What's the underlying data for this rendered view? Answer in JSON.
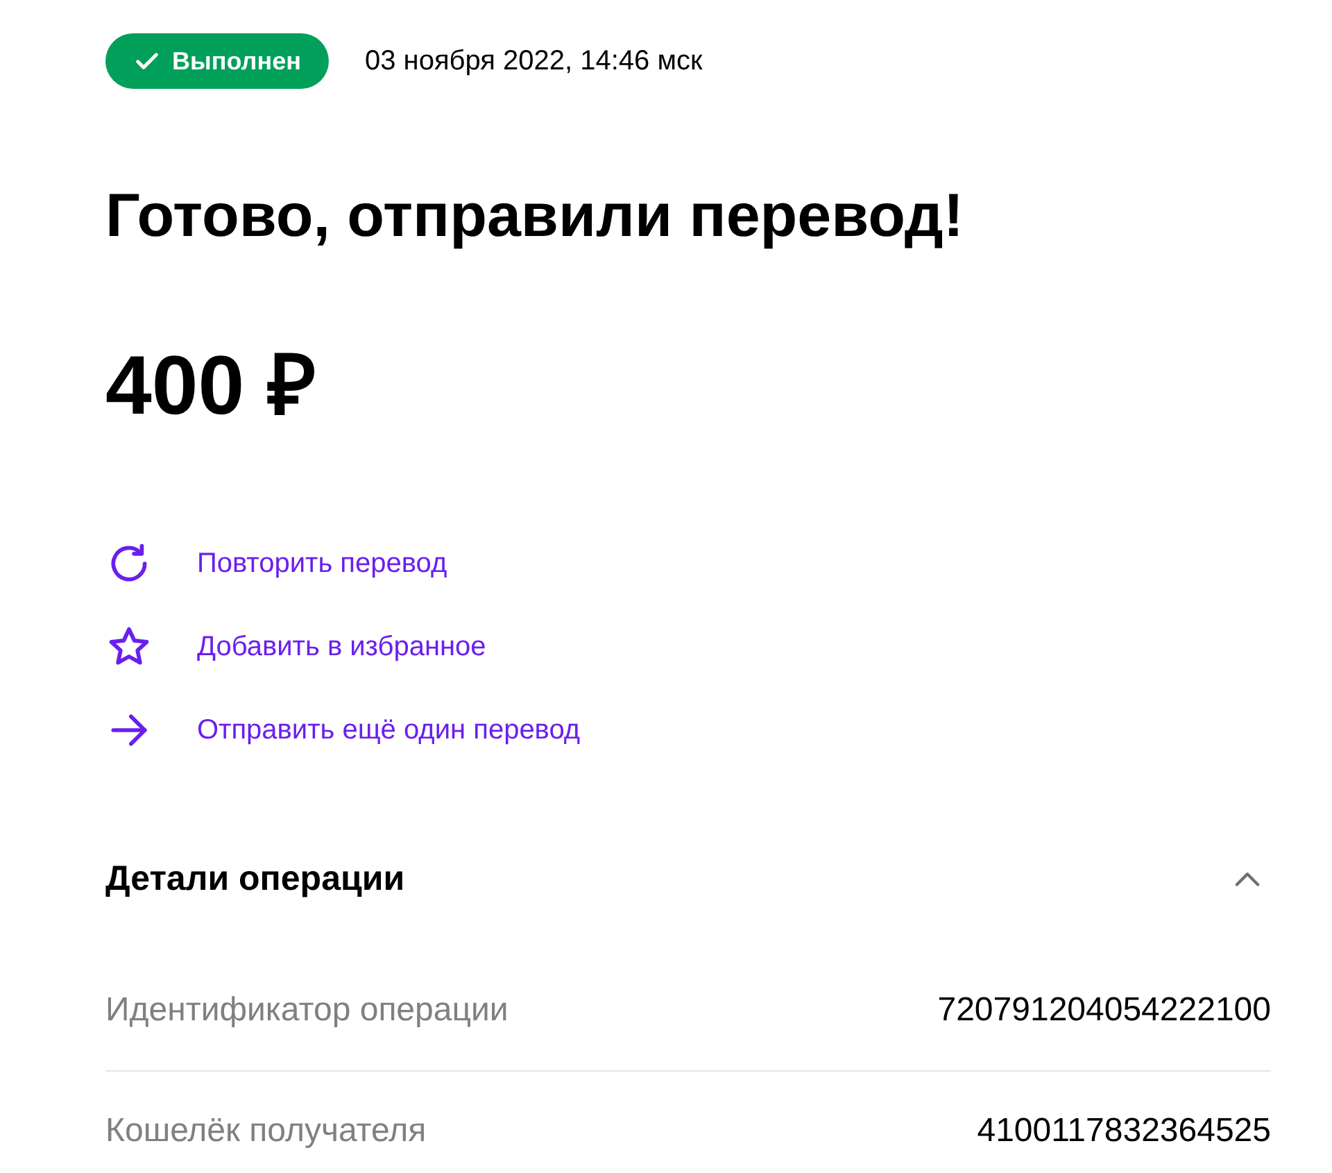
{
  "status": {
    "label": "Выполнен",
    "success": true
  },
  "date": "03 ноября 2022, 14:46 мск",
  "title": "Готово, отправили перевод!",
  "amount": "400 ₽",
  "actions": [
    {
      "kind": "repeat",
      "label": "Повторить перевод"
    },
    {
      "kind": "favorite",
      "label": "Добавить в избранное"
    },
    {
      "kind": "send",
      "label": "Отправить ещё один перевод"
    }
  ],
  "details": {
    "title": "Детали операции",
    "expanded": true,
    "rows": [
      {
        "label": "Идентификатор операции",
        "value": "720791204054222100"
      },
      {
        "label": "Кошелёк получателя",
        "value": "4100117832364525"
      }
    ]
  }
}
